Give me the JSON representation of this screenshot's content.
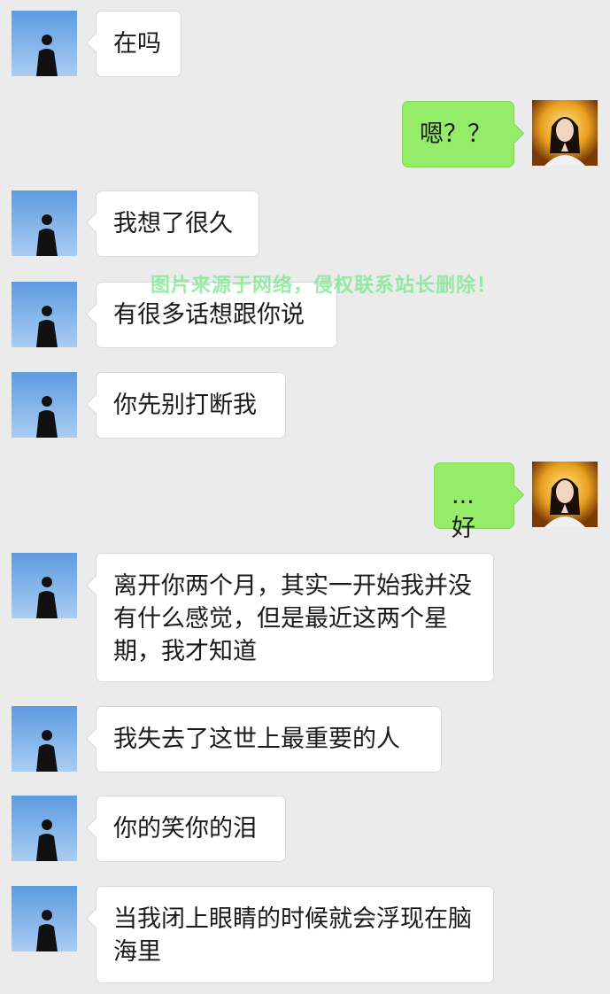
{
  "messages": [
    {
      "side": "in",
      "text": "在吗"
    },
    {
      "side": "out",
      "text": "嗯？？"
    },
    {
      "side": "in",
      "text": "我想了很久"
    },
    {
      "side": "in",
      "text": "有很多话想跟你说"
    },
    {
      "side": "in",
      "text": "你先别打断我"
    },
    {
      "side": "out",
      "text": "...好"
    },
    {
      "side": "in",
      "text": "离开你两个月，其实一开始我并没有什么感觉，但是最近这两个星期，我才知道"
    },
    {
      "side": "in",
      "text": "我失去了这世上最重要的人"
    },
    {
      "side": "in",
      "text": "你的笑你的泪"
    },
    {
      "side": "in",
      "text": "当我闭上眼睛的时候就会浮现在脑海里"
    }
  ],
  "watermark": "图片来源于网络，侵权联系站长删除！",
  "avatars": {
    "sender": "man-in-black-coat-blue-sky-avatar",
    "self": "woman-golden-halo-praying-avatar"
  },
  "colors": {
    "background": "#ebebeb",
    "incoming_bubble": "#ffffff",
    "outgoing_bubble": "#95ec69",
    "watermark": "#78e68c"
  }
}
